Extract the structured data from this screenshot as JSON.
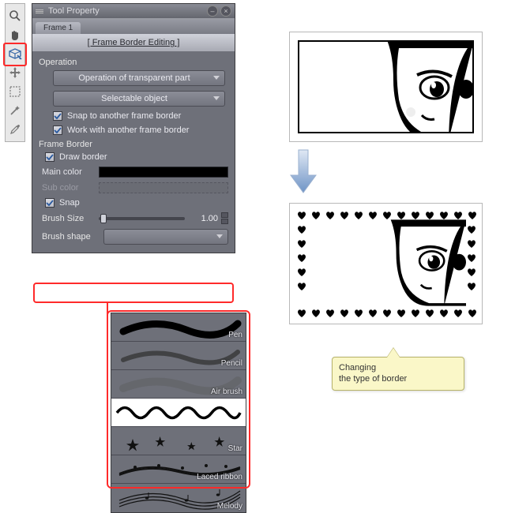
{
  "toolstrip": {
    "tools": [
      "zoom",
      "hand",
      "object",
      "operation",
      "marquee",
      "wand",
      "eyedropper"
    ]
  },
  "panel": {
    "title": "Tool Property",
    "tab": "Frame 1",
    "subtitle": "[ Frame Border Editing ]",
    "operation": {
      "label": "Operation",
      "dropdown1": "Operation of transparent part",
      "dropdown2": "Selectable object",
      "check1": "Snap to another frame border",
      "check2": "Work with another frame border"
    },
    "frameborder": {
      "label": "Frame Border",
      "draw_border": "Draw border",
      "main_color_label": "Main color",
      "main_color": "#000000",
      "sub_color_label": "Sub color",
      "snap": "Snap",
      "brush_size_label": "Brush Size",
      "brush_size_value": "1.00",
      "brush_shape_label": "Brush shape"
    }
  },
  "brush_popup": {
    "items": [
      "Pen",
      "Pencil",
      "Air brush",
      "",
      "Star",
      "Laced ribbon",
      "Melody"
    ]
  },
  "callout": {
    "text": "Changing\nthe type of border"
  }
}
